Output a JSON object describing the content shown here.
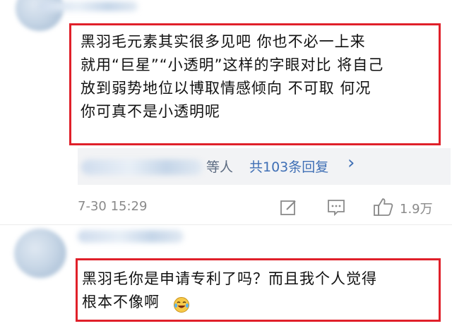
{
  "comment1": {
    "text": "黑羽毛元素其实很多见吧 你也不必一上来\n就用“巨星”“小透明”这样的字眼对比 将自己\n放到弱势地位以博取情感倾向 不可取 何况\n你可真不是小透明呢",
    "reply_suffix": "等人",
    "reply_link": "共103条回复",
    "reply_chevron": "›",
    "timestamp": "7-30 15:29",
    "like_count": "1.9万"
  },
  "comment2": {
    "text": "黑羽毛你是申请专利了吗？而且我个人觉得\n根本不像啊",
    "emoji": "laughing-crying-emoji"
  },
  "colors": {
    "highlight_border": "#e0202a",
    "link": "#3f6fb5",
    "meta_text": "#8a8a8a"
  },
  "icons": [
    "edit-icon",
    "comment-icon",
    "like-icon",
    "chevron-right-icon",
    "laughing-crying-emoji"
  ]
}
